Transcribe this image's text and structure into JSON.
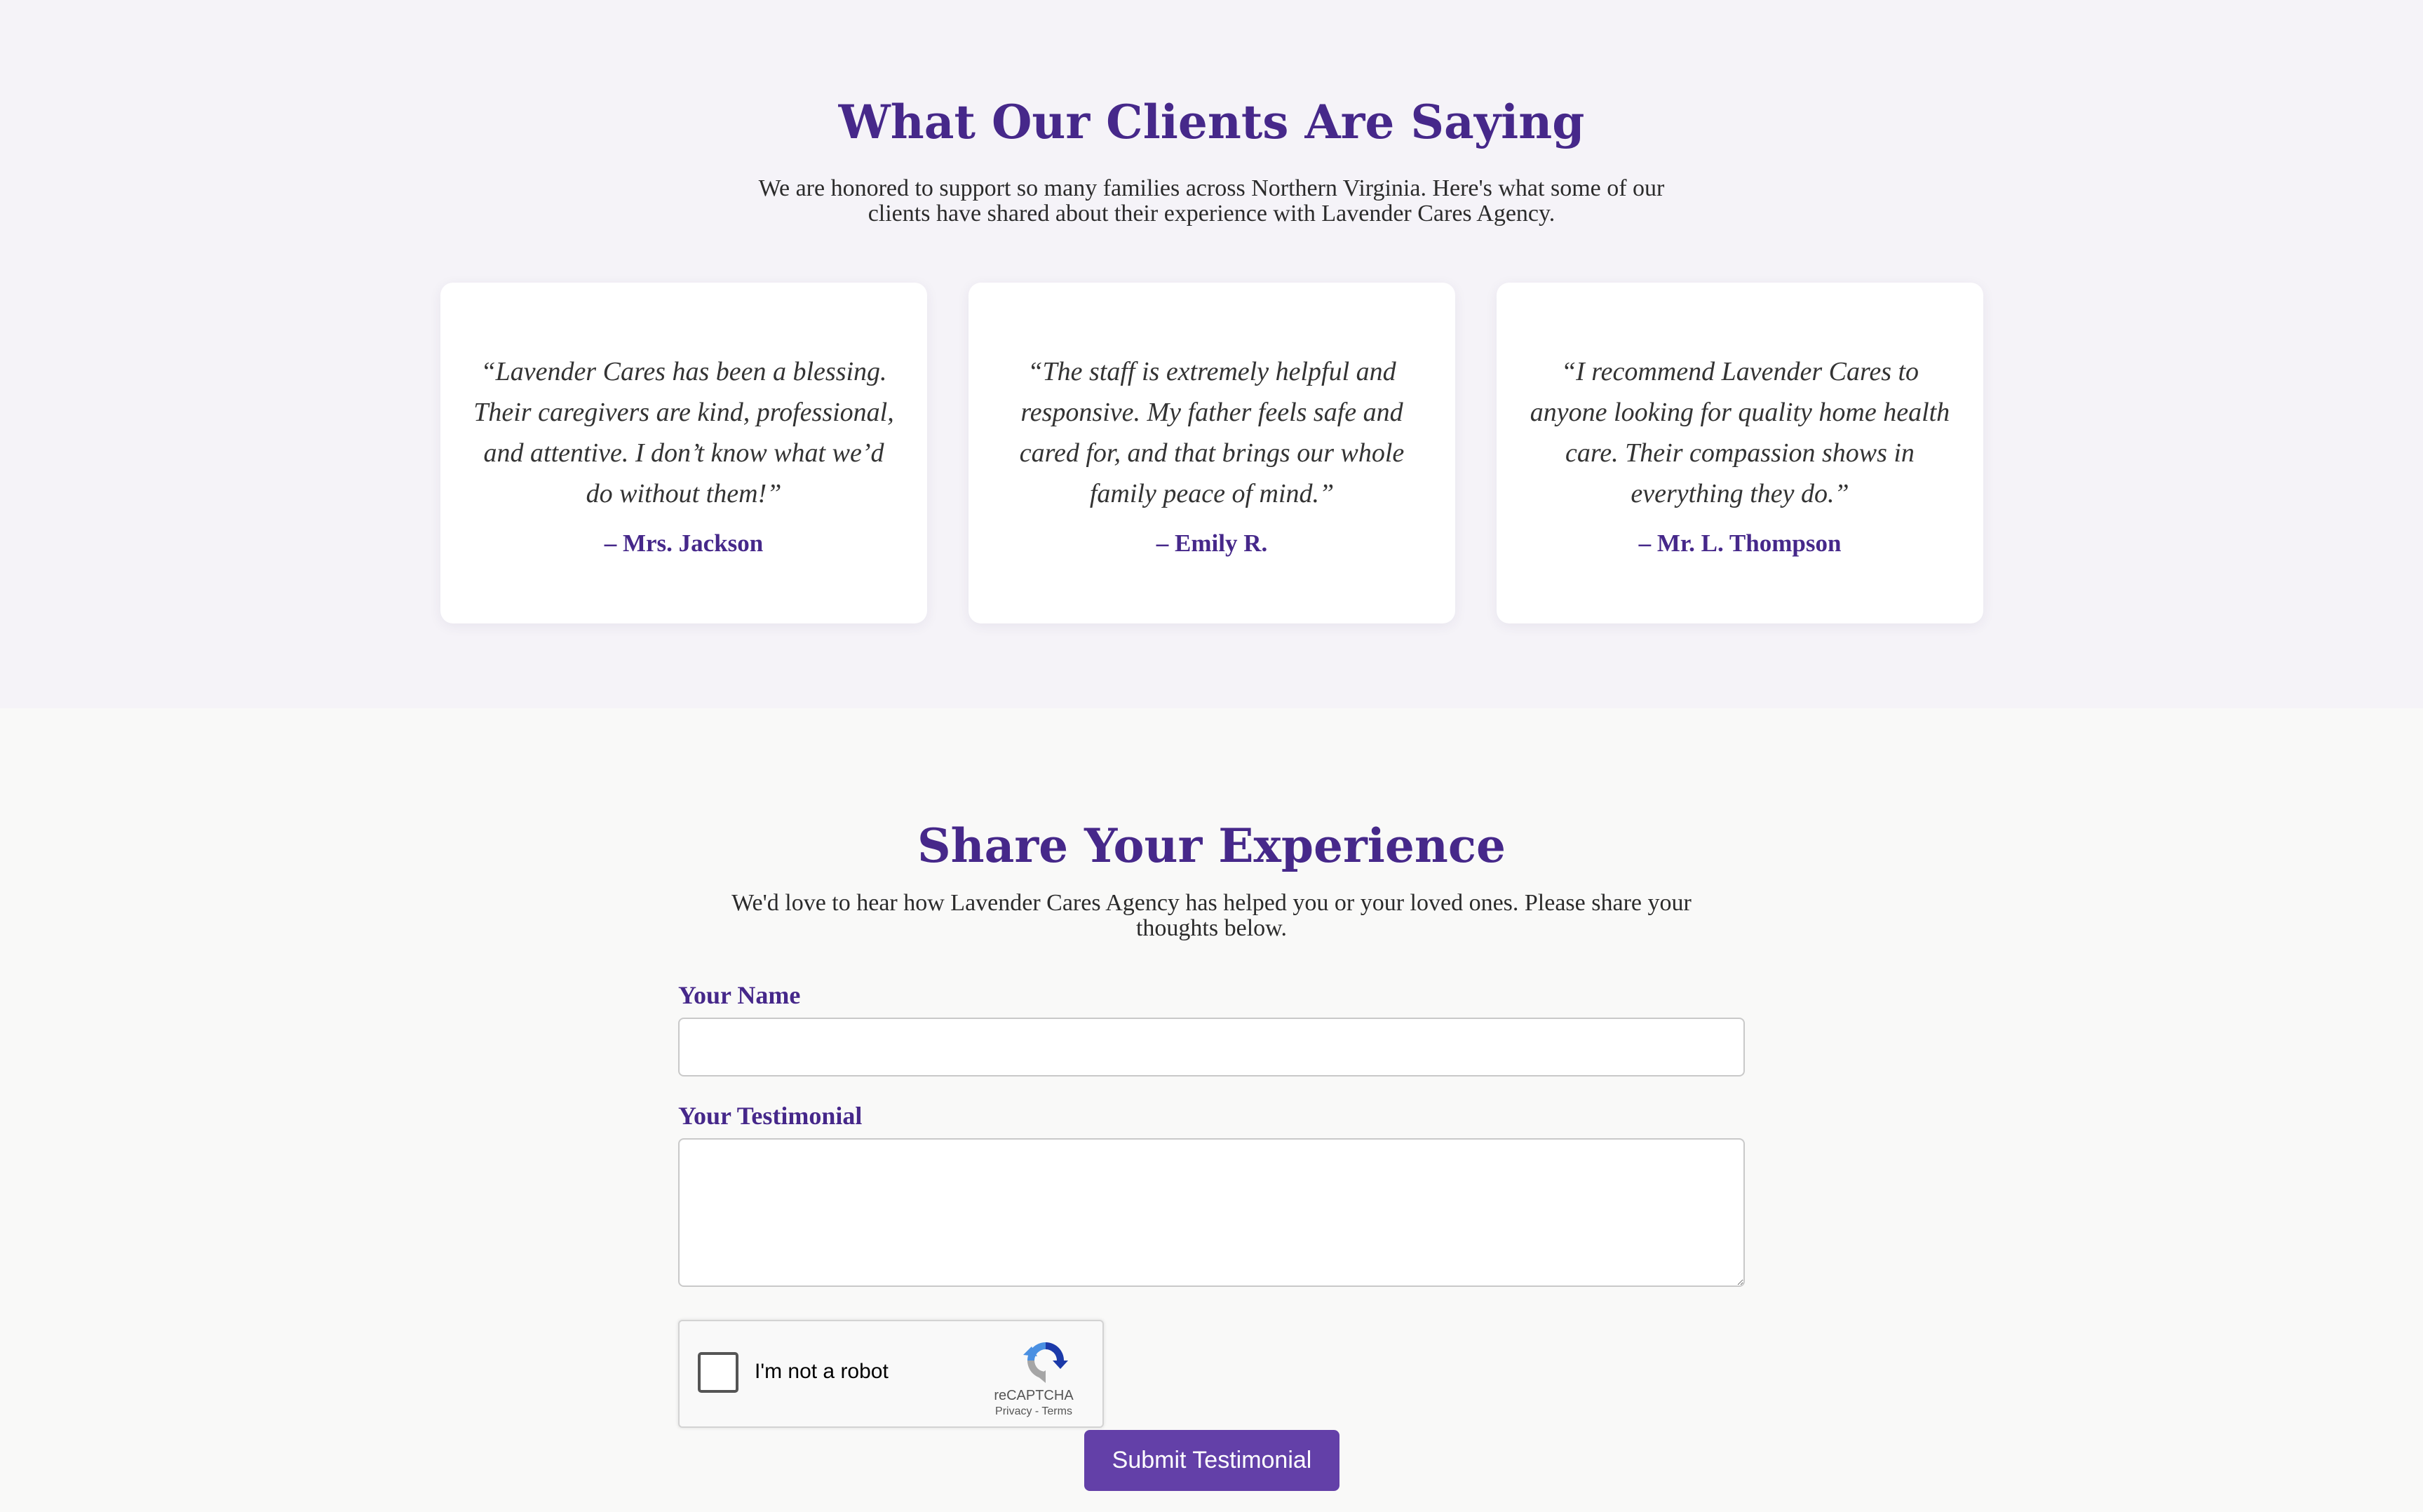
{
  "colors": {
    "brand_purple": "#46288a",
    "button_purple": "#6340a8",
    "testimonials_bg": "#f5f3f8",
    "form_bg": "#f9f9f8",
    "card_bg": "#ffffff"
  },
  "testimonials": {
    "title": "What Our Clients Are Saying",
    "subtitle": "We are honored to support so many families across Northern Virginia. Here's what some of our clients have shared about their experience with Lavender Cares Agency.",
    "cards": [
      {
        "quote": "“Lavender Cares has been a blessing. Their caregivers are kind, professional, and attentive. I don’t know what we’d do without them!”",
        "author": "– Mrs. Jackson"
      },
      {
        "quote": "“The staff is extremely helpful and responsive. My father feels safe and cared for, and that brings our whole family peace of mind.”",
        "author": "– Emily R."
      },
      {
        "quote": "“I recommend Lavender Cares to anyone looking for quality home health care. Their compassion shows in everything they do.”",
        "author": "– Mr. L. Thompson"
      }
    ]
  },
  "share": {
    "title": "Share Your Experience",
    "subtitle": "We'd love to hear how Lavender Cares Agency has helped you or your loved ones. Please share your thoughts below.",
    "name_label": "Your Name",
    "name_value": "",
    "testimonial_label": "Your Testimonial",
    "testimonial_value": "",
    "recaptcha": {
      "label": "I'm not a robot",
      "brand": "reCAPTCHA",
      "privacy": "Privacy",
      "separator": " - ",
      "terms": "Terms",
      "checked": false,
      "icon": "recaptcha-logo-icon"
    },
    "submit_label": "Submit Testimonial"
  }
}
